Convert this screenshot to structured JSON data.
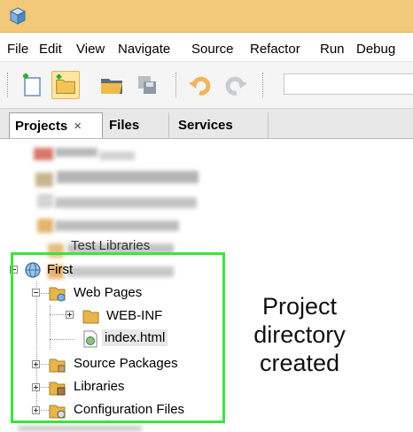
{
  "menu": [
    "File",
    "Edit",
    "View",
    "Navigate",
    "Source",
    "Refactor",
    "Run",
    "Debug"
  ],
  "tabs": [
    {
      "label": "Projects",
      "close": "×"
    },
    {
      "label": "Files"
    },
    {
      "label": "Services"
    }
  ],
  "tree": {
    "partial_label": "Test Libraries",
    "project": "First",
    "web_pages": "Web Pages",
    "web_inf": "WEB-INF",
    "index_file": "index.html",
    "source_packages": "Source Packages",
    "libraries": "Libraries",
    "config_files": "Configuration Files"
  },
  "annotation": {
    "line1": "Project",
    "line2": "directory",
    "line3": "created"
  },
  "colors": {
    "titlebar": "#f2c97a",
    "highlight_border": "#3fe33f",
    "folder": "#e9b548"
  }
}
